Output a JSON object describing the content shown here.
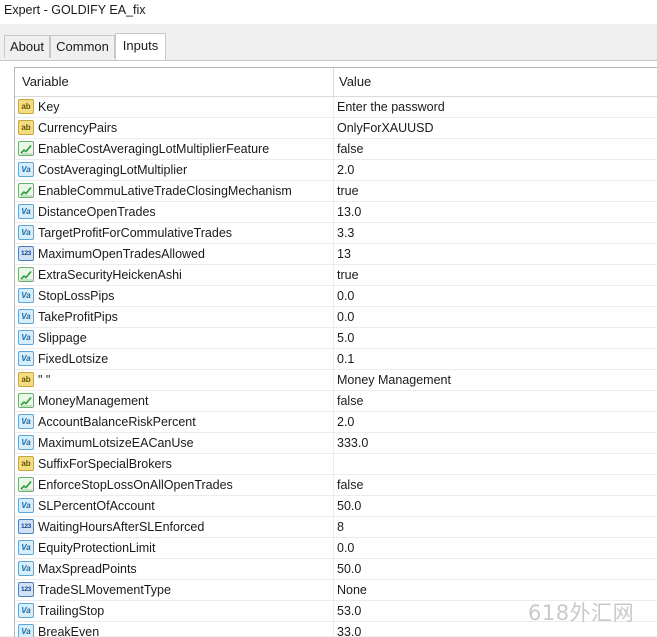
{
  "window": {
    "title": "Expert - GOLDIFY EA_fix"
  },
  "tabs": [
    {
      "label": "About"
    },
    {
      "label": "Common"
    },
    {
      "label": "Inputs"
    }
  ],
  "table": {
    "headers": {
      "variable": "Variable",
      "value": "Value"
    },
    "rows": [
      {
        "type": "string",
        "icon": "ab",
        "name": "Key",
        "value": "Enter the password"
      },
      {
        "type": "string",
        "icon": "ab",
        "name": "CurrencyPairs",
        "value": "OnlyForXAUUSD"
      },
      {
        "type": "bool",
        "icon": "",
        "name": "EnableCostAveragingLotMultiplierFeature",
        "value": "false"
      },
      {
        "type": "double",
        "icon": "Va",
        "name": "CostAveragingLotMultiplier",
        "value": "2.0"
      },
      {
        "type": "bool",
        "icon": "",
        "name": "EnableCommuLativeTradeClosingMechanism",
        "value": "true"
      },
      {
        "type": "double",
        "icon": "Va",
        "name": "DistanceOpenTrades",
        "value": "13.0"
      },
      {
        "type": "double",
        "icon": "Va",
        "name": "TargetProfitForCommulativeTrades",
        "value": "3.3"
      },
      {
        "type": "int",
        "icon": "123",
        "name": "MaximumOpenTradesAllowed",
        "value": "13"
      },
      {
        "type": "bool",
        "icon": "",
        "name": "ExtraSecurityHeickenAshi",
        "value": "true"
      },
      {
        "type": "double",
        "icon": "Va",
        "name": "StopLossPips",
        "value": "0.0"
      },
      {
        "type": "double",
        "icon": "Va",
        "name": "TakeProfitPips",
        "value": "0.0"
      },
      {
        "type": "double",
        "icon": "Va",
        "name": "Slippage",
        "value": "5.0"
      },
      {
        "type": "double",
        "icon": "Va",
        "name": "FixedLotsize",
        "value": "0.1"
      },
      {
        "type": "string",
        "icon": "ab",
        "name": "\" \"",
        "value": "Money Management"
      },
      {
        "type": "bool",
        "icon": "",
        "name": "MoneyManagement",
        "value": "false"
      },
      {
        "type": "double",
        "icon": "Va",
        "name": "AccountBalanceRiskPercent",
        "value": "2.0"
      },
      {
        "type": "double",
        "icon": "Va",
        "name": "MaximumLotsizeEACanUse",
        "value": "333.0"
      },
      {
        "type": "string",
        "icon": "ab",
        "name": "SuffixForSpecialBrokers",
        "value": ""
      },
      {
        "type": "bool",
        "icon": "",
        "name": "EnforceStopLossOnAllOpenTrades",
        "value": "false"
      },
      {
        "type": "double",
        "icon": "Va",
        "name": "SLPercentOfAccount",
        "value": "50.0"
      },
      {
        "type": "int",
        "icon": "123",
        "name": "WaitingHoursAfterSLEnforced",
        "value": "8"
      },
      {
        "type": "double",
        "icon": "Va",
        "name": "EquityProtectionLimit",
        "value": "0.0"
      },
      {
        "type": "double",
        "icon": "Va",
        "name": "MaxSpreadPoints",
        "value": "50.0"
      },
      {
        "type": "int",
        "icon": "123",
        "name": "TradeSLMovementType",
        "value": "None"
      },
      {
        "type": "double",
        "icon": "Va",
        "name": "TrailingStop",
        "value": "53.0"
      },
      {
        "type": "double",
        "icon": "Va",
        "name": "BreakEven",
        "value": "33.0"
      }
    ]
  },
  "watermark": "618外汇网",
  "colors": {
    "string_icon": "#f3dd83",
    "bool_icon": "#6ab36a",
    "double_icon": "#5ea7d6",
    "int_icon": "#4c80c2"
  }
}
